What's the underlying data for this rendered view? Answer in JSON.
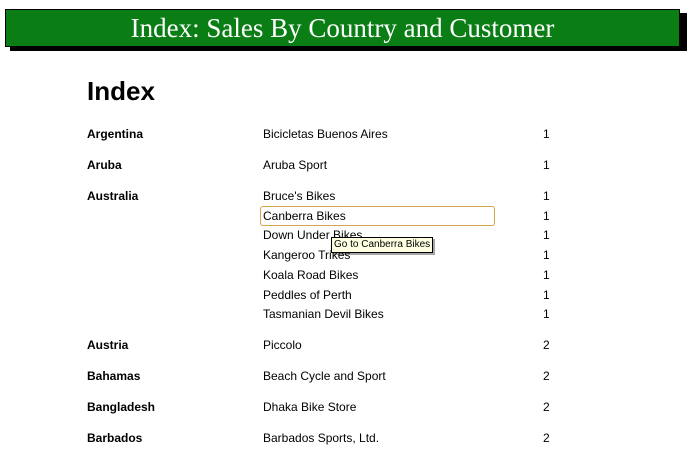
{
  "banner": {
    "title": "Index: Sales By Country and Customer"
  },
  "heading": "Index",
  "groups": [
    {
      "country": "Argentina",
      "entries": [
        {
          "customer": "Bicicletas Buenos Aires",
          "page": "1"
        }
      ]
    },
    {
      "country": "Aruba",
      "entries": [
        {
          "customer": "Aruba Sport",
          "page": "1"
        }
      ]
    },
    {
      "country": "Australia",
      "entries": [
        {
          "customer": "Bruce's Bikes",
          "page": "1"
        },
        {
          "customer": "Canberra Bikes",
          "page": "1"
        },
        {
          "customer": "Down Under Bikes",
          "page": "1"
        },
        {
          "customer": "Kangeroo Trikes",
          "page": "1"
        },
        {
          "customer": "Koala Road Bikes",
          "page": "1"
        },
        {
          "customer": "Peddles of Perth",
          "page": "1"
        },
        {
          "customer": "Tasmanian Devil Bikes",
          "page": "1"
        }
      ]
    },
    {
      "country": "Austria",
      "entries": [
        {
          "customer": "Piccolo",
          "page": "2"
        }
      ]
    },
    {
      "country": "Bahamas",
      "entries": [
        {
          "customer": "Beach Cycle and Sport",
          "page": "2"
        }
      ]
    },
    {
      "country": "Bangladesh",
      "entries": [
        {
          "customer": "Dhaka Bike Store",
          "page": "2"
        }
      ]
    },
    {
      "country": "Barbados",
      "entries": [
        {
          "customer": "Barbados Sports, Ltd.",
          "page": "2"
        }
      ]
    }
  ],
  "tooltip": "Go to Canberra Bikes",
  "focused": {
    "group": 2,
    "entry": 1
  }
}
